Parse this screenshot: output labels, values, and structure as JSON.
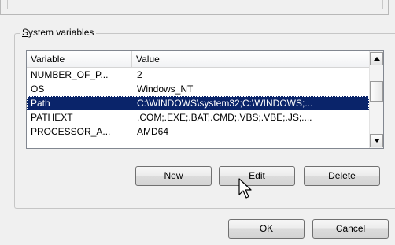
{
  "group": {
    "title_prefix": "S",
    "title_rest": "ystem variables"
  },
  "table": {
    "headers": {
      "variable": "Variable",
      "value": "Value"
    },
    "rows": [
      {
        "variable": "NUMBER_OF_P...",
        "value": "2",
        "selected": false
      },
      {
        "variable": "OS",
        "value": "Windows_NT",
        "selected": false
      },
      {
        "variable": "Path",
        "value": "C:\\WINDOWS\\system32;C:\\WINDOWS;...",
        "selected": true
      },
      {
        "variable": "PATHEXT",
        "value": ".COM;.EXE;.BAT;.CMD;.VBS;.VBE;.JS;....",
        "selected": false
      },
      {
        "variable": "PROCESSOR_A...",
        "value": "AMD64",
        "selected": false
      }
    ]
  },
  "buttons": {
    "new_pre": "Ne",
    "new_key": "w",
    "edit_pre": "E",
    "edit_key": "d",
    "edit_post": "it",
    "delete_pre": "Del",
    "delete_key": "e",
    "delete_post": "te",
    "ok": "OK",
    "cancel": "Cancel"
  },
  "icons": {
    "scroll_up": "triangle-up",
    "scroll_down": "triangle-down",
    "cursor": "arrow-pointer"
  },
  "colors": {
    "selection": "#0a246a",
    "window_bg": "#f0f0f0"
  }
}
